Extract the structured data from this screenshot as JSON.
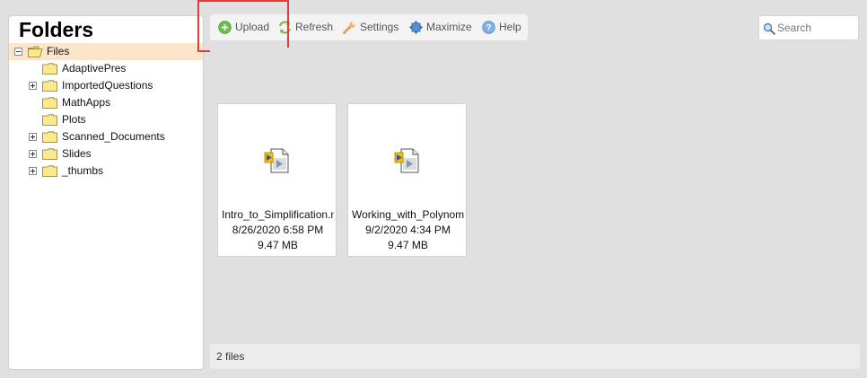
{
  "folders_panel": {
    "title": "Folders",
    "root": {
      "label": "Files",
      "expanded": true,
      "icon": "open-folder-icon"
    },
    "children": [
      {
        "label": "AdaptivePres",
        "expandable": false
      },
      {
        "label": "ImportedQuestions",
        "expandable": true
      },
      {
        "label": "MathApps",
        "expandable": false
      },
      {
        "label": "Plots",
        "expandable": false
      },
      {
        "label": "Scanned_Documents",
        "expandable": true
      },
      {
        "label": "Slides",
        "expandable": true
      },
      {
        "label": "_thumbs",
        "expandable": true
      }
    ]
  },
  "toolbar": {
    "upload_label": "Upload",
    "refresh_label": "Refresh",
    "settings_label": "Settings",
    "maximize_label": "Maximize",
    "help_label": "Help"
  },
  "search": {
    "placeholder": "Search",
    "value": ""
  },
  "files": [
    {
      "name": "Intro_to_Simplification.mov",
      "date": "8/26/2020 6:58 PM",
      "size": "9.47 MB",
      "icon": "video-file-icon"
    },
    {
      "name": "Working_with_Polynomials.mov",
      "date": "9/2/2020 4:34 PM",
      "size": "9.47 MB",
      "icon": "video-file-icon"
    }
  ],
  "status": {
    "text": "2 files"
  },
  "colors": {
    "highlight": "#e23b3b",
    "root_selected": "#fbe6cc",
    "folder_yellow": "#f7e27a",
    "upload_green": "#6cbf4c",
    "help_blue": "#4f8ed8"
  }
}
